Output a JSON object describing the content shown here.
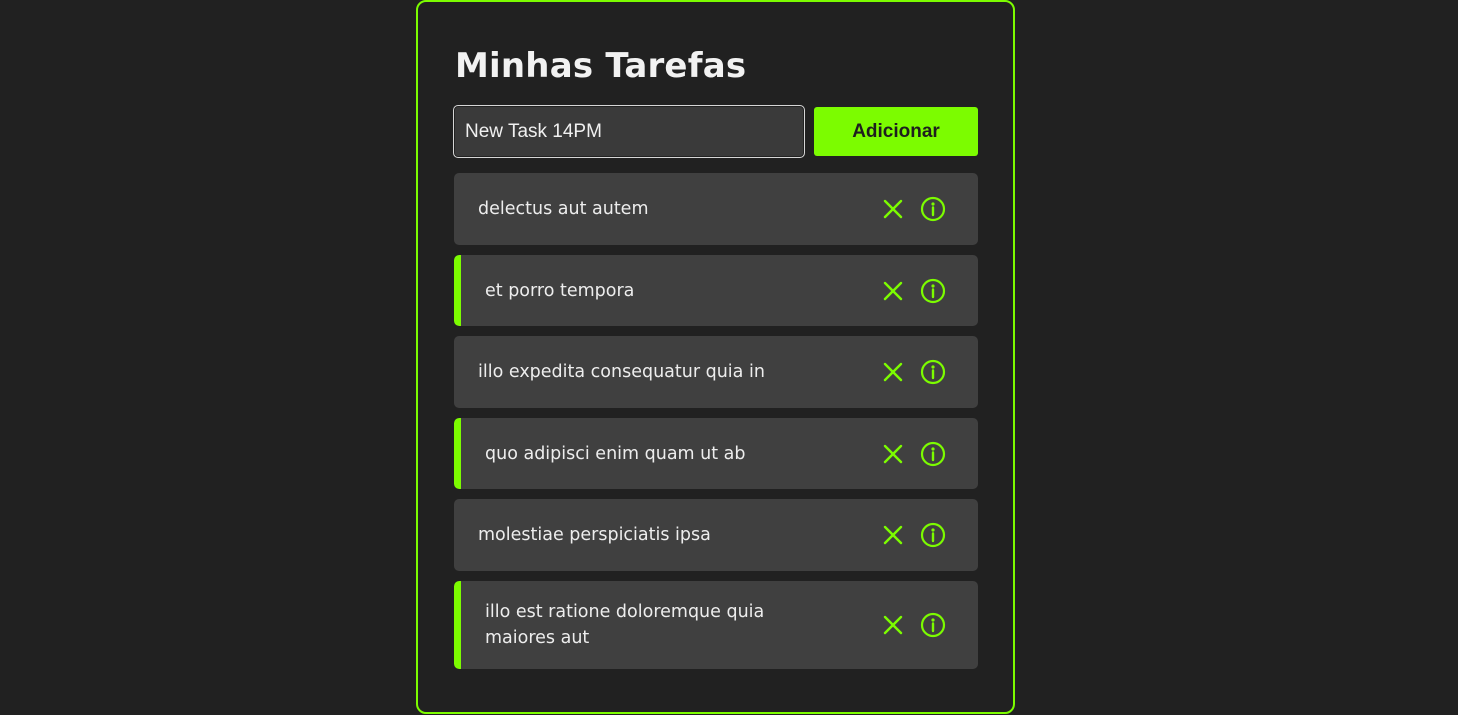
{
  "app": {
    "title": "Minhas Tarefas",
    "accent_color": "#7cfc00"
  },
  "form": {
    "input_value": "New Task 14PM",
    "add_label": "Adicionar"
  },
  "tasks": [
    {
      "text": "delectus aut autem",
      "completed": false
    },
    {
      "text": "et porro tempora",
      "completed": true
    },
    {
      "text": "illo expedita consequatur quia in",
      "completed": false
    },
    {
      "text": "quo adipisci enim quam ut ab",
      "completed": true
    },
    {
      "text": "molestiae perspiciatis ipsa",
      "completed": false
    },
    {
      "text": "illo est ratione doloremque quia maiores aut",
      "completed": true
    }
  ],
  "icons": {
    "delete": "close-icon",
    "info": "info-icon"
  }
}
